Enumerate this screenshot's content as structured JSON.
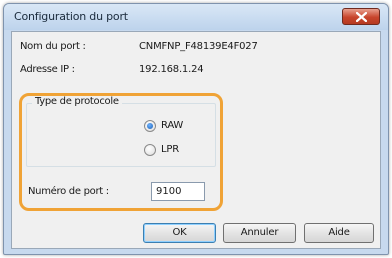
{
  "window": {
    "title": "Configuration du port"
  },
  "fields": {
    "port_name_label": "Nom du port :",
    "port_name_value": "CNMFNP_F48139E4F027",
    "ip_label": "Adresse IP :",
    "ip_value": "192.168.1.24"
  },
  "protocol": {
    "legend": "Type de protocole",
    "options": [
      {
        "label": "RAW",
        "selected": true
      },
      {
        "label": "LPR",
        "selected": false
      }
    ]
  },
  "port_number": {
    "label": "Numéro de port :",
    "value": "9100"
  },
  "buttons": {
    "ok": "OK",
    "cancel": "Annuler",
    "help": "Aide"
  },
  "colors": {
    "highlight": "#f0a336",
    "close_button": "#c8452c",
    "titlebar": "#c7d9ee"
  }
}
